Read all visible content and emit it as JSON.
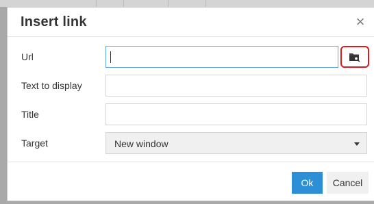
{
  "dialog": {
    "title": "Insert link",
    "close_icon": "close-icon",
    "close_glyph": "×"
  },
  "form": {
    "url": {
      "label": "Url",
      "value": "",
      "browse_icon": "browse-folder-icon"
    },
    "text_to_display": {
      "label": "Text to display",
      "value": ""
    },
    "title": {
      "label": "Title",
      "value": ""
    },
    "target": {
      "label": "Target",
      "selected": "New window"
    }
  },
  "footer": {
    "ok_label": "Ok",
    "cancel_label": "Cancel"
  },
  "colors": {
    "primary_button": "#2d8fd5",
    "focus_border": "#59a5e5",
    "highlight_box": "#e0161d"
  }
}
